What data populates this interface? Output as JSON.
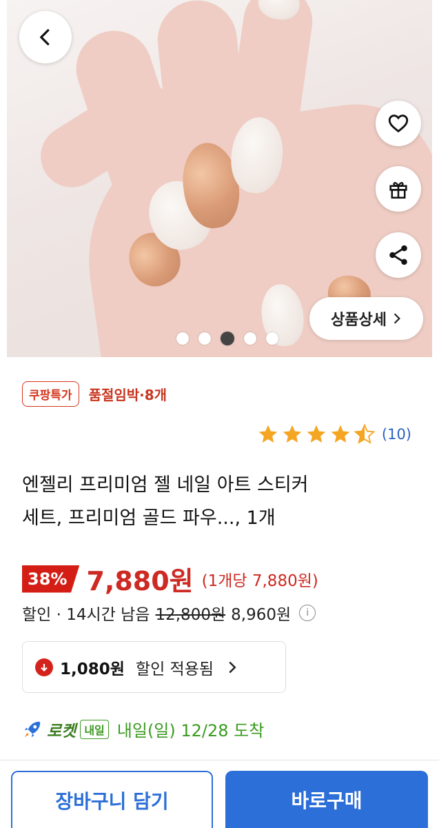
{
  "hero": {
    "detail_button": "상품상세",
    "slide_count": 5,
    "active_slide": 3
  },
  "badges": {
    "coupang_special": "쿠팡특가",
    "stock_warning": "품절임박·8개"
  },
  "rating": {
    "stars": 4.5,
    "count": "(10)",
    "star_color": "#f5a524"
  },
  "product": {
    "title_line1": "엔젤리 프리미엄 젤 네일 아트 스티커",
    "title_line2": "세트, 프리미엄 골드 파우..., 1개"
  },
  "price": {
    "discount_rate": "38%",
    "sale_price": "7,880원",
    "unit_price": "(1개당 7,880원)",
    "discount_label": "할인 · 14시간 남음",
    "original_price": "12,800원",
    "instant_price": "8,960원",
    "info_glyph": "i"
  },
  "coupon": {
    "amount": "1,080원",
    "text": "할인 적용됨"
  },
  "delivery": {
    "rocket_label": "로켓",
    "tomorrow_badge": "내일",
    "arrival_text": "내일(일) 12/28 도착"
  },
  "actions": {
    "cart": "장바구니 담기",
    "buy": "바로구매"
  },
  "colors": {
    "accent_blue": "#2c6fd8",
    "sale_red": "#cc2a22",
    "rocket_green": "#3a9a1f"
  }
}
